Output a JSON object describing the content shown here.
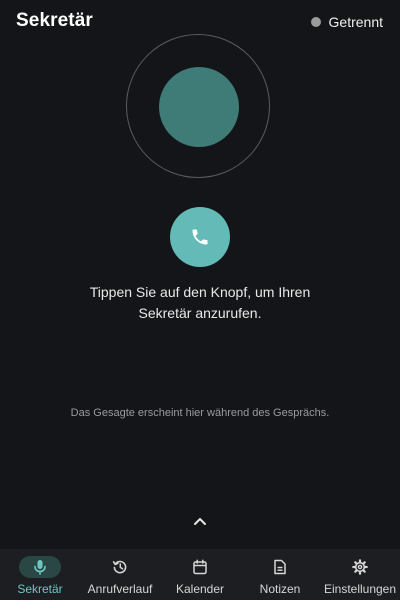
{
  "header": {
    "title": "Sekretär",
    "status_label": "Getrennt",
    "status_dot_color": "#9b9b9b"
  },
  "main": {
    "voice_orb": {
      "ring_color": "#5a5b5f",
      "orb_color": "#3f7b77"
    },
    "call_button": {
      "icon": "phone-icon",
      "color": "#63bab7"
    },
    "prompt_line1": "Tippen Sie auf den Knopf, um Ihren",
    "prompt_line2": "Sekretär anzurufen.",
    "transcript_placeholder": "Das Gesagte erscheint hier während des Gesprächs.",
    "expand_icon": "chevron-up-icon"
  },
  "nav": {
    "active_color": "#6cc8c3",
    "items": [
      {
        "label": "Sekretär",
        "icon": "microphone-icon",
        "active": true
      },
      {
        "label": "Anrufverlauf",
        "icon": "history-icon",
        "active": false
      },
      {
        "label": "Kalender",
        "icon": "calendar-icon",
        "active": false
      },
      {
        "label": "Notizen",
        "icon": "document-icon",
        "active": false
      },
      {
        "label": "Einstellungen",
        "icon": "gear-icon",
        "active": false
      }
    ]
  }
}
